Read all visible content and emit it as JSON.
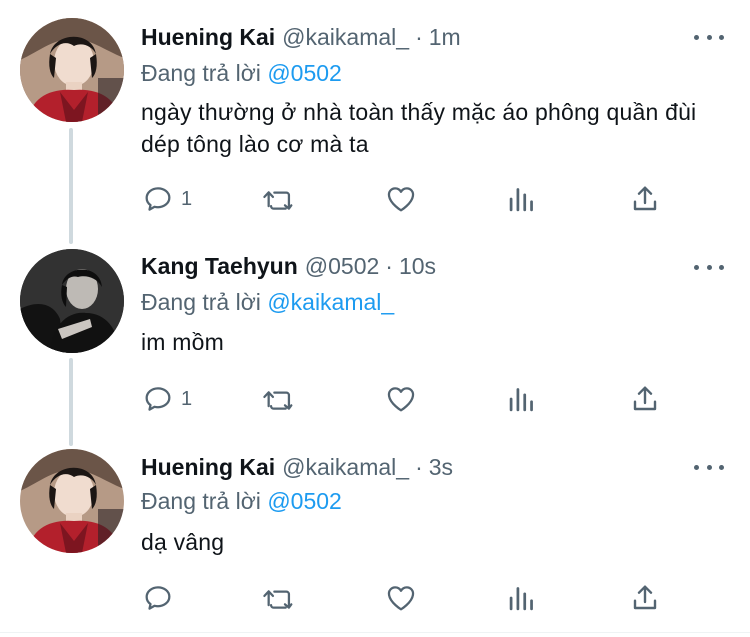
{
  "tweets": [
    {
      "name": "Huening Kai",
      "handle": "@kaikamal_",
      "separator": "·",
      "time": "1m",
      "replying_prefix": "Đang trả lời",
      "replying_to": "@0502",
      "text": "ngày thường ở nhà toàn thấy mặc áo phông quần đùi dép tông lào cơ mà ta",
      "reply_count": "1"
    },
    {
      "name": "Kang Taehyun",
      "handle": "@0502",
      "separator": "·",
      "time": "10s",
      "replying_prefix": "Đang trả lời",
      "replying_to": "@kaikamal_",
      "text": "im mồm",
      "reply_count": "1"
    },
    {
      "name": "Huening Kai",
      "handle": "@kaikamal_",
      "separator": "·",
      "time": "3s",
      "replying_prefix": "Đang trả lời",
      "replying_to": "@0502",
      "text": "dạ vâng",
      "reply_count": ""
    }
  ],
  "icons": {
    "reply": "reply-icon",
    "retweet": "retweet-icon",
    "like": "heart-icon",
    "analytics": "analytics-icon",
    "share": "share-icon",
    "more": "more-dots-icon"
  },
  "colors": {
    "text": "#0f1419",
    "secondary": "#536471",
    "link": "#1d9bf0",
    "thread_line": "#cfd9de"
  }
}
